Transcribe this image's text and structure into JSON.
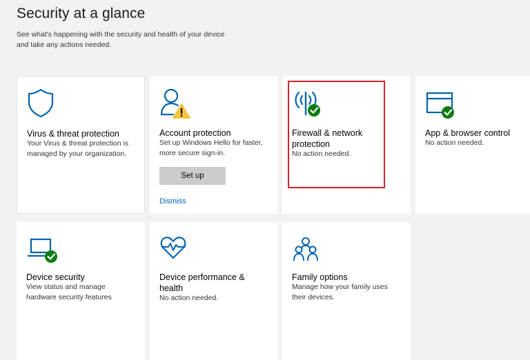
{
  "header": {
    "title": "Security at a glance",
    "subtitle": "See what's happening with the security and health of your device and take any actions needed."
  },
  "colors": {
    "accent": "#0063b1",
    "ok": "#107c10",
    "warning": "#ffc83d",
    "highlight": "#d81e28"
  },
  "tiles": {
    "virus": {
      "icon": "shield-icon",
      "title": "Virus & threat protection",
      "description": "Your Virus & threat protection is managed by your organization."
    },
    "account": {
      "icon": "account-warning-icon",
      "title": "Account protection",
      "description": "Set up Windows Hello for faster, more secure sign-in.",
      "button_label": "Set up",
      "link_label": "Dismiss"
    },
    "firewall": {
      "icon": "firewall-antenna-icon",
      "title": "Firewall & network protection",
      "description": "No action needed."
    },
    "app_browser": {
      "icon": "app-browser-icon",
      "title": "App & browser control",
      "description": "No action needed."
    },
    "device_security": {
      "icon": "laptop-icon",
      "title": "Device security",
      "description": "View status and manage hardware security features"
    },
    "device_performance": {
      "icon": "heart-pulse-icon",
      "title": "Device performance & health",
      "description": "No action needed."
    },
    "family": {
      "icon": "family-icon",
      "title": "Family options",
      "description": "Manage how your family uses their devices."
    }
  }
}
